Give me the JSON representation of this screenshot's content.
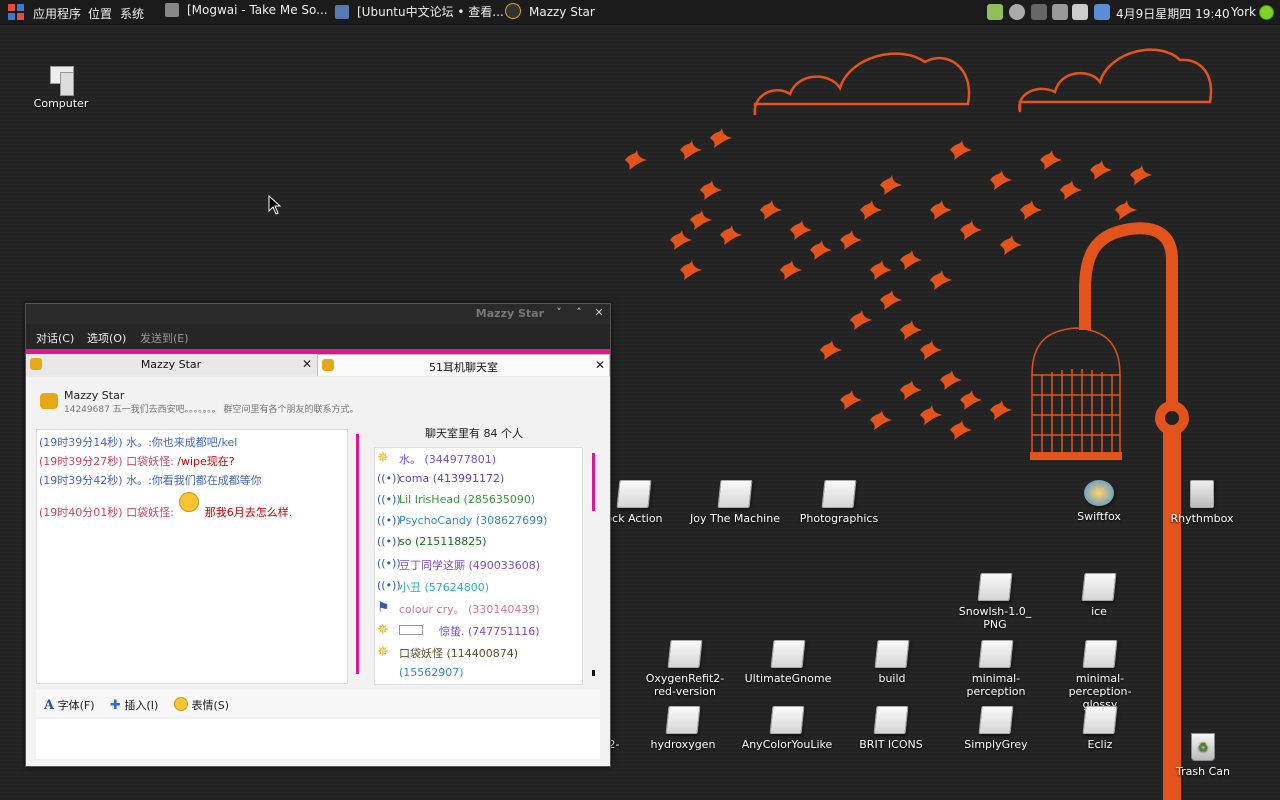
{
  "panel": {
    "menus": [
      "应用程序",
      "位置",
      "系统"
    ],
    "tasks": [
      "[Mogwai - Take Me So...",
      "[Ubuntu中文论坛 • 查看...",
      "Mazzy Star"
    ],
    "clock": "4月9日星期四 19:40",
    "user": "York"
  },
  "desktop": {
    "computer_label": "Computer",
    "icons": [
      {
        "label": "ock Action"
      },
      {
        "label": "Joy The Machine"
      },
      {
        "label": "Photographics"
      },
      {
        "label": "Swiftfox"
      },
      {
        "label": "Rhythmbox"
      },
      {
        "label": "Snowlsh-1.0_\nPNG"
      },
      {
        "label": "ice"
      },
      {
        "label": "OxygenRefit2-\nred-version"
      },
      {
        "label": "UltimateGnome"
      },
      {
        "label": "build"
      },
      {
        "label": "minimal-\nperception"
      },
      {
        "label": "minimal-\nperception-\nglossy"
      },
      {
        "label": "2-"
      },
      {
        "label": "hydroxygen"
      },
      {
        "label": "AnyColorYouLike"
      },
      {
        "label": "BRIT ICONS"
      },
      {
        "label": "SimplyGrey"
      },
      {
        "label": "Ecliz"
      },
      {
        "label": "Trash Can"
      }
    ]
  },
  "window": {
    "title": "Mazzy Star",
    "menu": [
      "对话(C)",
      "选项(O)",
      "发送到(E)"
    ],
    "tabs": [
      "Mazzy Star",
      "51耳机聊天室"
    ],
    "profile": {
      "name": "Mazzy Star",
      "signature": "14249687 五一我们去西安吧。。。。。。。 群空间里有各个朋友的联系方式。"
    },
    "messages": [
      {
        "time": "(19时39分14秒)",
        "sender": "水。:",
        "text": "你也来成都吧/kel"
      },
      {
        "time": "(19时39分27秒)",
        "sender": "口袋妖怪:",
        "text": "/wipe现在?"
      },
      {
        "time": "(19时39分42秒)",
        "sender": "水。:",
        "text": "你看我们都在成都等你"
      },
      {
        "time": "(19时40分01秒)",
        "sender": "口袋妖怪:",
        "text": "那我6月去怎么样."
      }
    ],
    "members_title": "聊天室里有 84 个人",
    "members": [
      {
        "name": "水。 (344977801)",
        "color": "#7a4fd0",
        "icon": "star-icon"
      },
      {
        "name": "coma (413991172)",
        "color": "#6b3fb5",
        "icon": "broadcast-icon"
      },
      {
        "name": "Lil IrisHead (285635090)",
        "color": "#3a9a3a",
        "icon": "broadcast-icon"
      },
      {
        "name": "PsychoCandy (308627699)",
        "color": "#3a8fb0",
        "icon": "broadcast-icon"
      },
      {
        "name": "so (215118825)",
        "color": "#1a6a1a",
        "icon": "broadcast-icon"
      },
      {
        "name": "豆丁同学这厮 (490033608)",
        "color": "#7a4fd0",
        "icon": "broadcast-icon"
      },
      {
        "name": "小丑 (57624800)",
        "color": "#2ab0c8",
        "icon": "broadcast-icon"
      },
      {
        "name": "colour cry。 (330140439)",
        "color": "#d07aa0",
        "icon": "flag-icon"
      },
      {
        "name": "惊蛰. (747751116)",
        "color": "#7a4fd0",
        "icon": "star-icon"
      },
      {
        "name": "口袋妖怪 (114400874)",
        "color": "#5a4f2a",
        "icon": "star-icon"
      },
      {
        "name": "(15562907)",
        "color": "#3a8fb0",
        "icon": "none"
      }
    ],
    "toolbar": {
      "font": "字体(F)",
      "insert": "插入(I)",
      "emoticon": "表情(S)"
    }
  }
}
